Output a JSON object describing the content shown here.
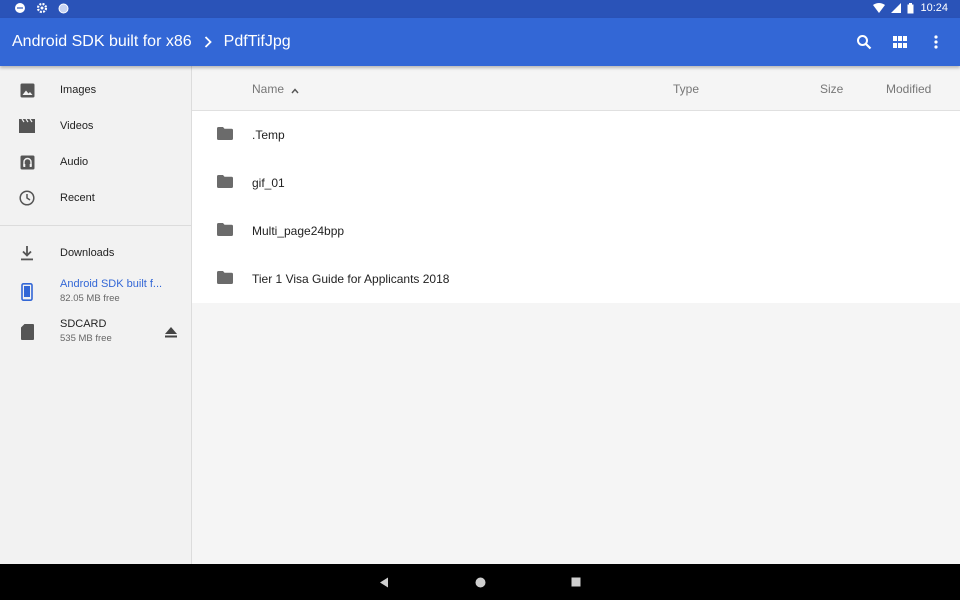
{
  "status_bar": {
    "time": "10:24",
    "left_icons": [
      "chat-icon",
      "gear-icon",
      "circle-icon"
    ],
    "right_icons": [
      "wifi-icon",
      "signal-icon",
      "battery-icon"
    ]
  },
  "app_bar": {
    "breadcrumb": [
      "Android SDK built for x86",
      "PdfTifJpg"
    ],
    "actions": [
      "search-icon",
      "grid-view-icon",
      "more-vert-icon"
    ],
    "background": "#3367d6"
  },
  "sidebar": {
    "items": [
      {
        "label": "Images",
        "icon": "image-icon"
      },
      {
        "label": "Videos",
        "icon": "video-icon"
      },
      {
        "label": "Audio",
        "icon": "audio-icon"
      },
      {
        "label": "Recent",
        "icon": "clock-icon"
      }
    ],
    "storage": [
      {
        "label": "Downloads",
        "sub": "",
        "icon": "download-icon"
      },
      {
        "label": "Android SDK built f...",
        "sub": "82.05 MB free",
        "icon": "phone-icon",
        "active": true
      },
      {
        "label": "SDCARD",
        "sub": "535 MB free",
        "icon": "sdcard-icon",
        "eject": "eject-icon"
      }
    ],
    "accent": "#3367d6"
  },
  "list": {
    "columns": {
      "name": "Name",
      "type": "Type",
      "size": "Size",
      "modified": "Modified"
    },
    "sort": "name-ascending",
    "rows": [
      {
        "name": ".Temp",
        "icon": "folder-icon"
      },
      {
        "name": "gif_01",
        "icon": "folder-icon"
      },
      {
        "name": "Multi_page24bpp",
        "icon": "folder-icon"
      },
      {
        "name": "Tier 1 Visa Guide for Applicants 2018",
        "icon": "folder-icon"
      }
    ]
  },
  "nav_bar": {
    "buttons": [
      "back-icon",
      "home-icon",
      "recents-icon"
    ]
  }
}
